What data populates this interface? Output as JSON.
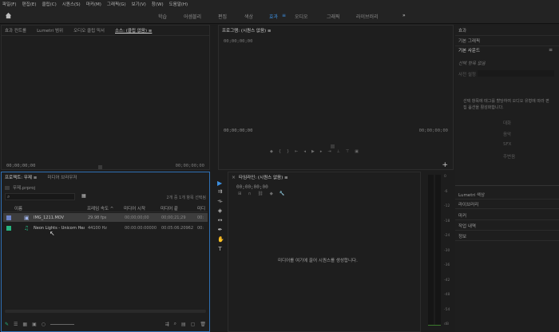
{
  "menu": [
    "파일(F)",
    "편집(E)",
    "클립(C)",
    "시퀀스(S)",
    "마커(M)",
    "그래픽(G)",
    "보기(V)",
    "창(W)",
    "도움말(H)"
  ],
  "workspaces": [
    {
      "label": "학습",
      "active": false
    },
    {
      "label": "어셈블리",
      "active": false
    },
    {
      "label": "편집",
      "active": false
    },
    {
      "label": "색상",
      "active": false
    },
    {
      "label": "효과",
      "active": true
    },
    {
      "label": "오디오",
      "active": false
    },
    {
      "label": "그래픽",
      "active": false
    },
    {
      "label": "라이브러리",
      "active": false
    }
  ],
  "workspace_more": "»",
  "source_panel": {
    "tabs": [
      "효과 컨트롤",
      "Lumetri 범위",
      "오디오 클립 믹서",
      "소스: (클립 없음) ≡"
    ],
    "active_tab": 3,
    "tc_left": "00;00;00;00",
    "tc_right": "00;00;00;00"
  },
  "program_panel": {
    "title": "프로그램: (시퀀스 없음) ≡",
    "tc_top": "00;00;00;00",
    "tc_left": "00;00;00;00",
    "tc_right": "00;00;00;00"
  },
  "right_panel": {
    "effects": "효과",
    "basic_graphics": "기본 그래픽",
    "essential_sound": "기본 사운드",
    "sound_sub": "선택 항목 없음",
    "sound_preset": "사전 설정",
    "hint": "선택 항목에 태그를 할당하여 오디오 유형에 따라 편집 옵션을 활성화합니다.",
    "types": [
      "대화",
      "음악",
      "SFX",
      "주변음"
    ],
    "panels": [
      "Lumetri 색상",
      "라이브러리",
      "마커",
      "작업 내역",
      "정보"
    ]
  },
  "project_panel": {
    "tabs": [
      "프로젝트: 무제 ≡",
      "미디어 브라우저"
    ],
    "project_file": "무제.prproj",
    "selection_info": "2개 중 1개 항목 선택됨",
    "columns": [
      "이름",
      "프레임 속도 ^",
      "미디어 시작",
      "미디어 끝",
      "미디"
    ],
    "rows": [
      {
        "name": "IMG_1211.MOV",
        "rate": "29.98 fps",
        "start": "00;00;00;00",
        "end": "00;00;21;29",
        "extra": "00:",
        "selected": true,
        "color": "#6c84c9"
      },
      {
        "name": "Neon Lights - Unicorn Hea",
        "rate": "44100 Hz",
        "start": "00:00:00:00000",
        "end": "00:05:06:20962",
        "extra": "00:",
        "selected": false,
        "color": "#27b47f"
      }
    ]
  },
  "timeline_panel": {
    "title": "타임라인: (시퀀스 없음) ≡",
    "timecode": "00;00;00;00",
    "empty_msg": "미디어를 여기에 끌어 시퀀스를 생성합니다."
  },
  "meter_labels": [
    "0",
    "-6",
    "-12",
    "-18",
    "-24",
    "-30",
    "-36",
    "-42",
    "-48",
    "-54",
    "dB"
  ]
}
